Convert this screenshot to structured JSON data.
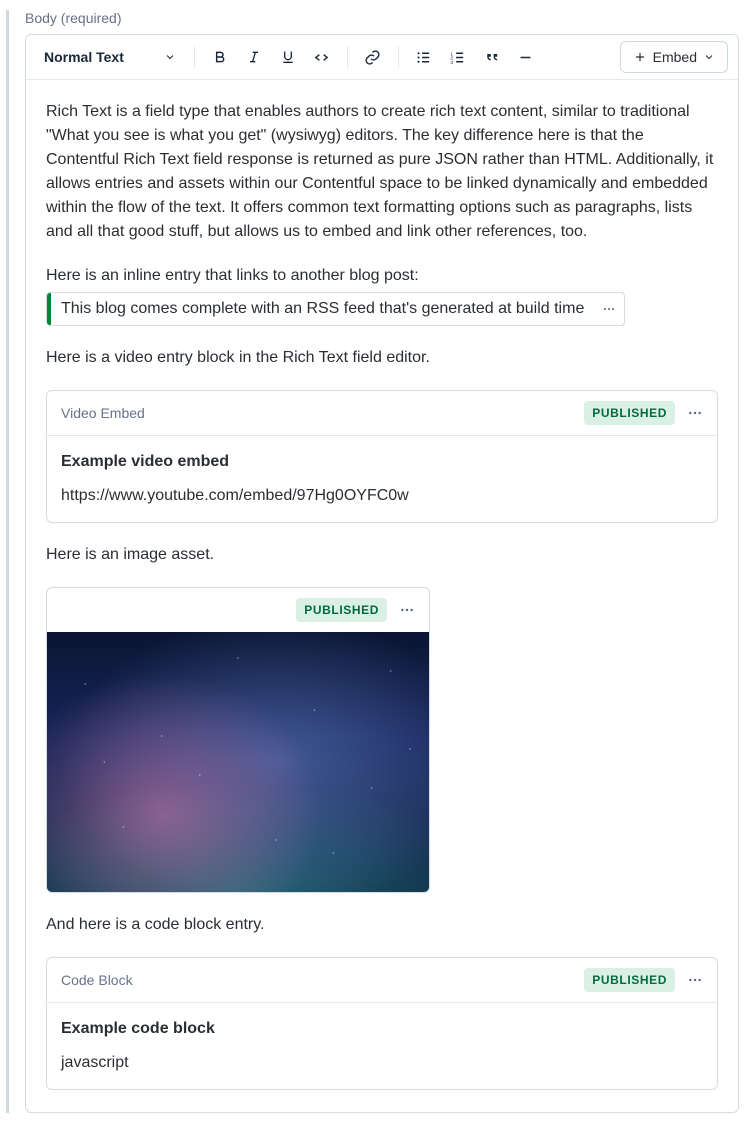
{
  "field": {
    "label": "Body (required)"
  },
  "toolbar": {
    "format_label": "Normal Text",
    "embed_label": "Embed"
  },
  "content": {
    "p1": "Rich Text is a field type that enables authors to create rich text content, similar to traditional \"What you see is what you get\" (wysiwyg) editors. The key difference here is that the Contentful Rich Text field response is returned as pure JSON rather than HTML. Additionally, it allows entries and assets within our Contentful space to be linked dynamically and embedded within the flow of the text. It offers common text formatting options such as paragraphs, lists and all that good stuff, but allows us to embed and link other references, too.",
    "p2": "Here is an inline entry that links to another blog post:",
    "inline_entry_text": "This blog comes complete with an RSS feed that's generated at build time",
    "p3": "Here is a video entry block in the Rich Text field editor.",
    "p4": "Here is an image asset.",
    "p5": "And here is a code block entry."
  },
  "video_block": {
    "type_label": "Video Embed",
    "status": "PUBLISHED",
    "title": "Example video embed",
    "url": "https://www.youtube.com/embed/97Hg0OYFC0w"
  },
  "asset_block": {
    "status": "PUBLISHED"
  },
  "code_block": {
    "type_label": "Code Block",
    "status": "PUBLISHED",
    "title": "Example code block",
    "language": "javascript"
  }
}
